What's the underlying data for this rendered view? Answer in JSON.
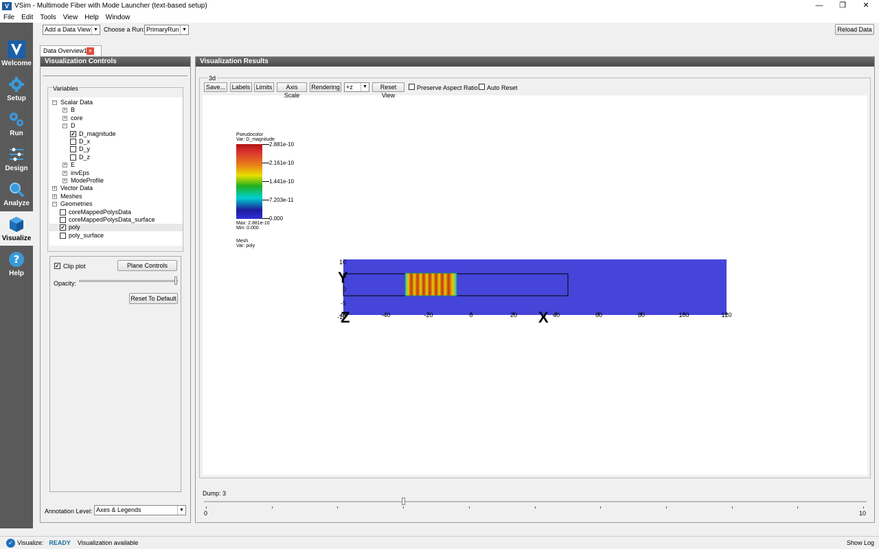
{
  "window": {
    "title": "VSim - Multimode Fiber with Mode Launcher (text-based setup)",
    "min": "—",
    "restore": "❐",
    "close": "✕"
  },
  "menu": [
    "File",
    "Edit",
    "Tools",
    "View",
    "Help",
    "Window"
  ],
  "sidebar": [
    {
      "label": "Welcome",
      "icon": "vsim-logo-icon"
    },
    {
      "label": "Setup",
      "icon": "gear-icon"
    },
    {
      "label": "Run",
      "icon": "gears-icon"
    },
    {
      "label": "Design",
      "icon": "design-icon"
    },
    {
      "label": "Analyze",
      "icon": "magnifier-icon"
    },
    {
      "label": "Visualize",
      "icon": "cube-icon",
      "active": true
    },
    {
      "label": "Help",
      "icon": "help-icon"
    }
  ],
  "toolbar": {
    "add_view": "Add a Data View",
    "choose_run_label": "Choose a Run:",
    "run_value": "PrimaryRun",
    "reload": "Reload Data"
  },
  "tab": {
    "label": "Data Overview1"
  },
  "controls": {
    "header": "Visualization Controls",
    "variables_label": "Variables",
    "tree": [
      {
        "text": "Scalar Data",
        "exp": "−",
        "indent": 0
      },
      {
        "text": "B",
        "exp": "+",
        "indent": 1
      },
      {
        "text": "core",
        "exp": "+",
        "indent": 1
      },
      {
        "text": "D",
        "exp": "−",
        "indent": 1
      },
      {
        "text": "D_magnitude",
        "cb": true,
        "indent": 2
      },
      {
        "text": "D_x",
        "cb": false,
        "indent": 2
      },
      {
        "text": "D_y",
        "cb": false,
        "indent": 2
      },
      {
        "text": "D_z",
        "cb": false,
        "indent": 2
      },
      {
        "text": "E",
        "exp": "+",
        "indent": 1
      },
      {
        "text": "invEps",
        "exp": "+",
        "indent": 1
      },
      {
        "text": "ModeProfile",
        "exp": "+",
        "indent": 1
      },
      {
        "text": "Vector Data",
        "exp": "+",
        "indent": 0
      },
      {
        "text": "Meshes",
        "exp": "+",
        "indent": 0
      },
      {
        "text": "Geometries",
        "exp": "−",
        "indent": 0
      },
      {
        "text": "coreMappedPolysData",
        "cb": false,
        "indent": 1
      },
      {
        "text": "coreMappedPolysData_surface",
        "cb": false,
        "indent": 1
      },
      {
        "text": "poly",
        "cb": true,
        "indent": 1,
        "sel": true
      },
      {
        "text": "poly_surface",
        "cb": false,
        "indent": 1
      }
    ],
    "clip_plot": "Clip plot",
    "plane_controls": "Plane Controls",
    "opacity": "Opacity:",
    "reset_default": "Reset To Default",
    "annotation_label": "Annotation Level:",
    "annotation_value": "Axes & Legends"
  },
  "results": {
    "header": "Visualization Results",
    "group": "3d",
    "buttons": [
      "Save...",
      "Labels",
      "Limits",
      "Axis Scale",
      "Rendering"
    ],
    "view_dir": "+z",
    "reset_view": "Reset View",
    "preserve_aspect": "Preserve Aspect Ratio",
    "auto_reset": "Auto Reset",
    "legend": {
      "title": "Pseudocolor",
      "var": "Var: D_magnitude",
      "ticks": [
        "2.881e-10",
        "2.161e-10",
        "1.441e-10",
        "7.203e-11",
        "0.000"
      ],
      "max": "Max:  2.881e-10",
      "min": "Min:  0.000",
      "mesh": "Mesh",
      "mesh_var": "Var: poly"
    },
    "plot": {
      "x_ticks": [
        "-60",
        "-40",
        "-20",
        "0",
        "20",
        "40",
        "60",
        "80",
        "100",
        "120"
      ],
      "y_ticks": [
        "10",
        "5",
        "0",
        "-5",
        "-10"
      ],
      "x_axis": "X",
      "y_axis": "Y",
      "z_axis": "Z",
      "bg_color": "#4545d9"
    }
  },
  "dump": {
    "label": "Dump: 3",
    "min": "0",
    "max": "10",
    "value": 3
  },
  "status": {
    "prefix": "Visualize:",
    "state": "READY",
    "message": "Visualization available",
    "show_log": "Show Log"
  }
}
